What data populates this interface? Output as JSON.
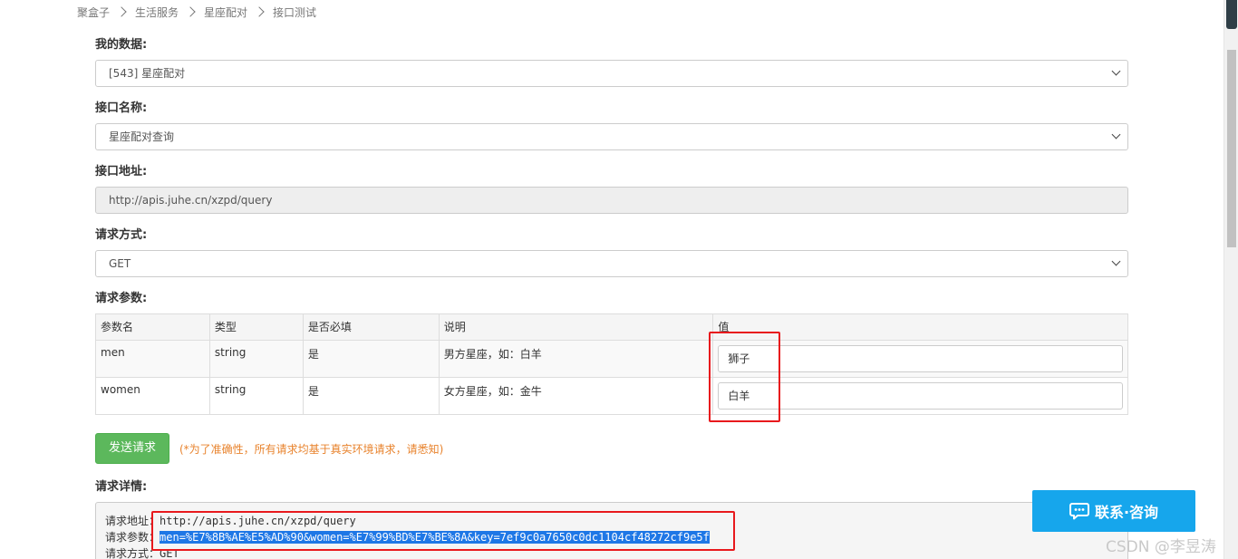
{
  "breadcrumb": [
    "聚盒子",
    "生活服务",
    "星座配对",
    "接口测试"
  ],
  "form": {
    "my_data_label": "我的数据:",
    "my_data_value": "[543] 星座配对",
    "api_name_label": "接口名称:",
    "api_name_value": "星座配对查询",
    "api_url_label": "接口地址:",
    "api_url_value": "http://apis.juhe.cn/xzpd/query",
    "method_label": "请求方式:",
    "method_value": "GET",
    "params_label": "请求参数:"
  },
  "params_table": {
    "headers": [
      "参数名",
      "类型",
      "是否必填",
      "说明",
      "值"
    ],
    "rows": [
      {
        "name": "men",
        "type": "string",
        "required": "是",
        "desc": "男方星座，如：白羊",
        "value": "狮子"
      },
      {
        "name": "women",
        "type": "string",
        "required": "是",
        "desc": "女方星座，如：金牛",
        "value": "白羊"
      }
    ]
  },
  "send": {
    "button_label": "发送请求",
    "notice": "(*为了准确性，所有请求均基于真实环境请求，请悉知)"
  },
  "detail": {
    "label": "请求详情:",
    "url_prefix": "请求地址：",
    "url_value": "http://apis.juhe.cn/xzpd/query",
    "params_prefix": "请求参数：",
    "params_value": "men=%E7%8B%AE%E5%AD%90&women=%E7%99%BD%E7%BE%8A&key=7ef9c0a7650c0dc1104cf48272cf9e5f",
    "method_prefix": "请求方式：",
    "method_value": "GET"
  },
  "contact": {
    "label": "联系·咨询",
    "icon": "chat-bubble-icon"
  },
  "watermark": "CSDN @李昱涛",
  "colors": {
    "send_button": "#5cb85c",
    "notice_text": "#e8832d",
    "contact_button": "#16a6ec",
    "highlight": "#1e77e6",
    "annotation_red": "#e8191d"
  }
}
